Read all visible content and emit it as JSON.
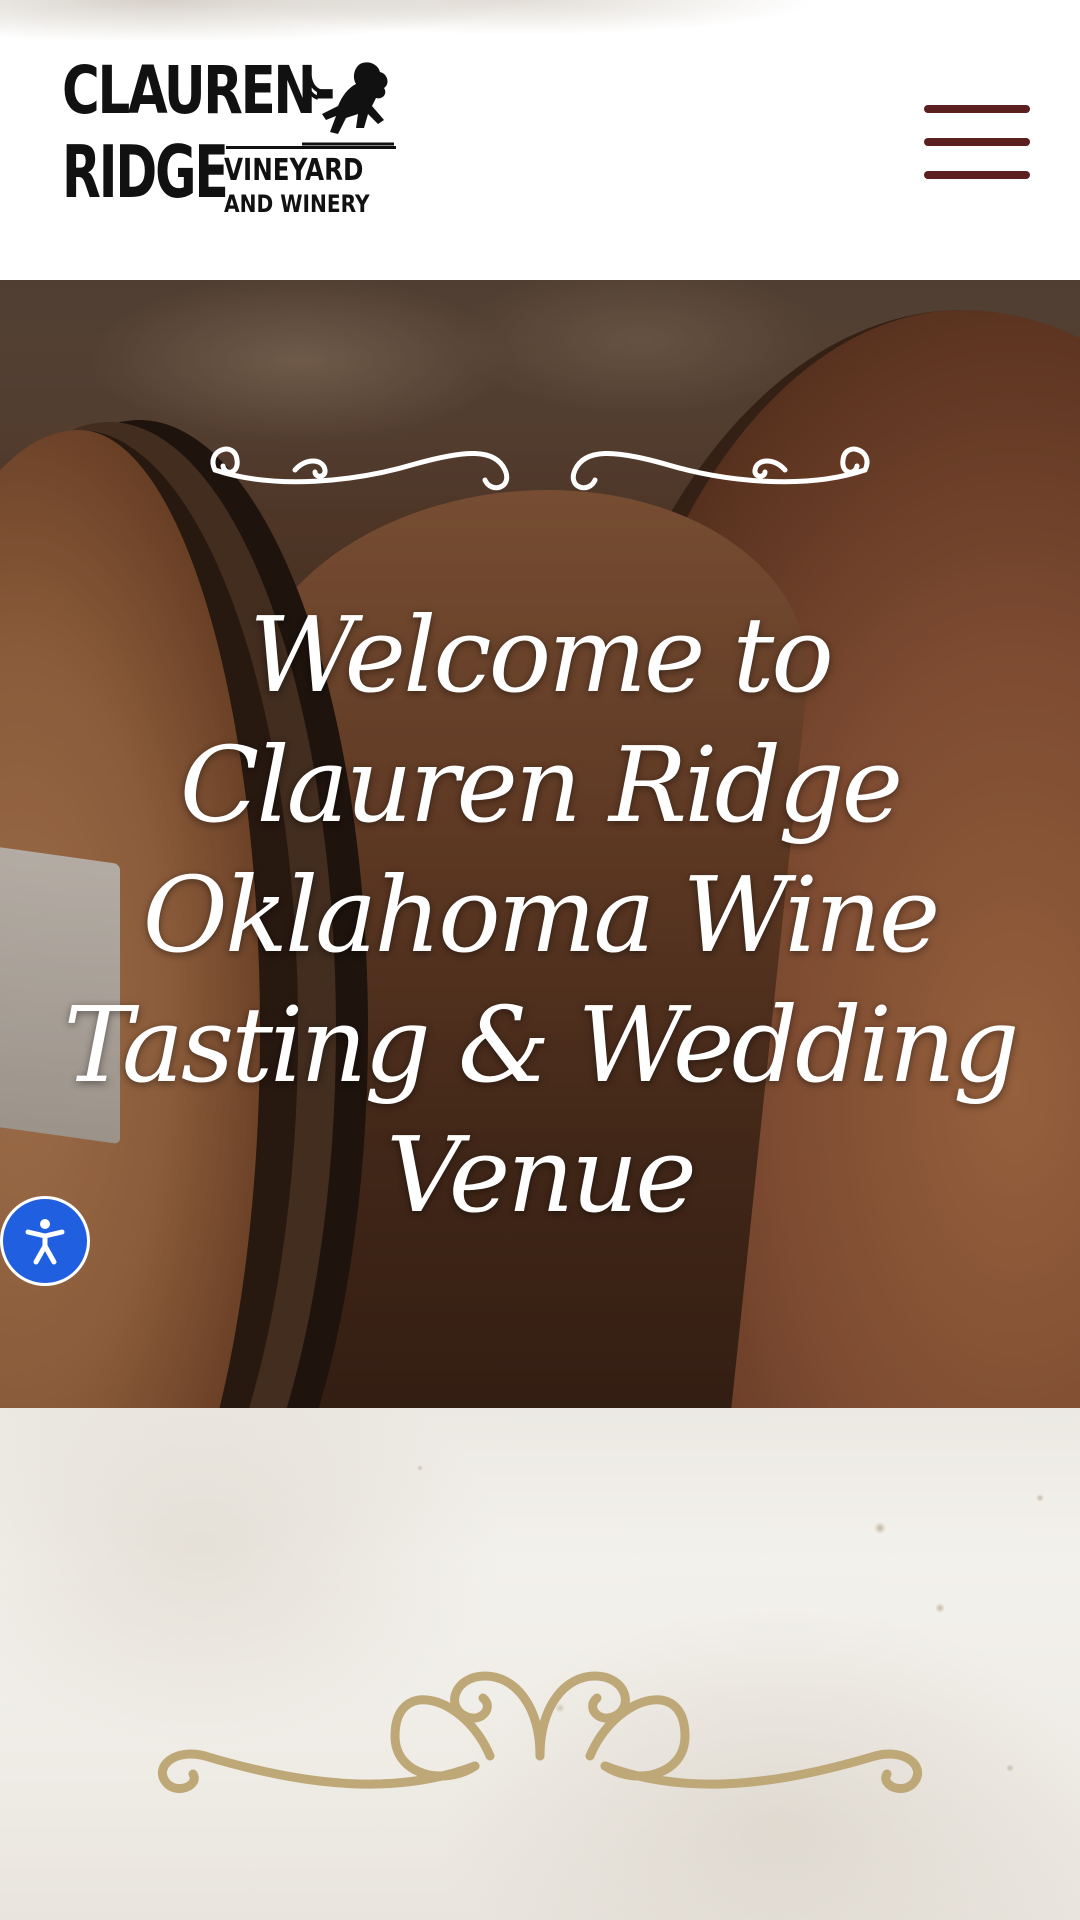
{
  "header": {
    "logo": {
      "line1": "CLAUREN-",
      "line2": "RIDGE",
      "sub1": "VINEYARD",
      "sub2": "AND WINERY",
      "emblem_icon": "lion-icon"
    },
    "menu_icon": "hamburger-menu-icon"
  },
  "hero": {
    "title": "Welcome to Clauren Ridge Oklahoma Wine Tasting & Wedding Venue",
    "flourish_icon": "scroll-flourish-icon"
  },
  "accessibility": {
    "icon": "accessibility-person-icon",
    "color": "#1f5fe0"
  },
  "section": {
    "flourish_icon": "gold-flourish-icon",
    "flourish_color": "#bfa878"
  },
  "colors": {
    "menu": "#5b1f1f",
    "hero_text": "#ffffff",
    "paper_background": "#efece6"
  }
}
